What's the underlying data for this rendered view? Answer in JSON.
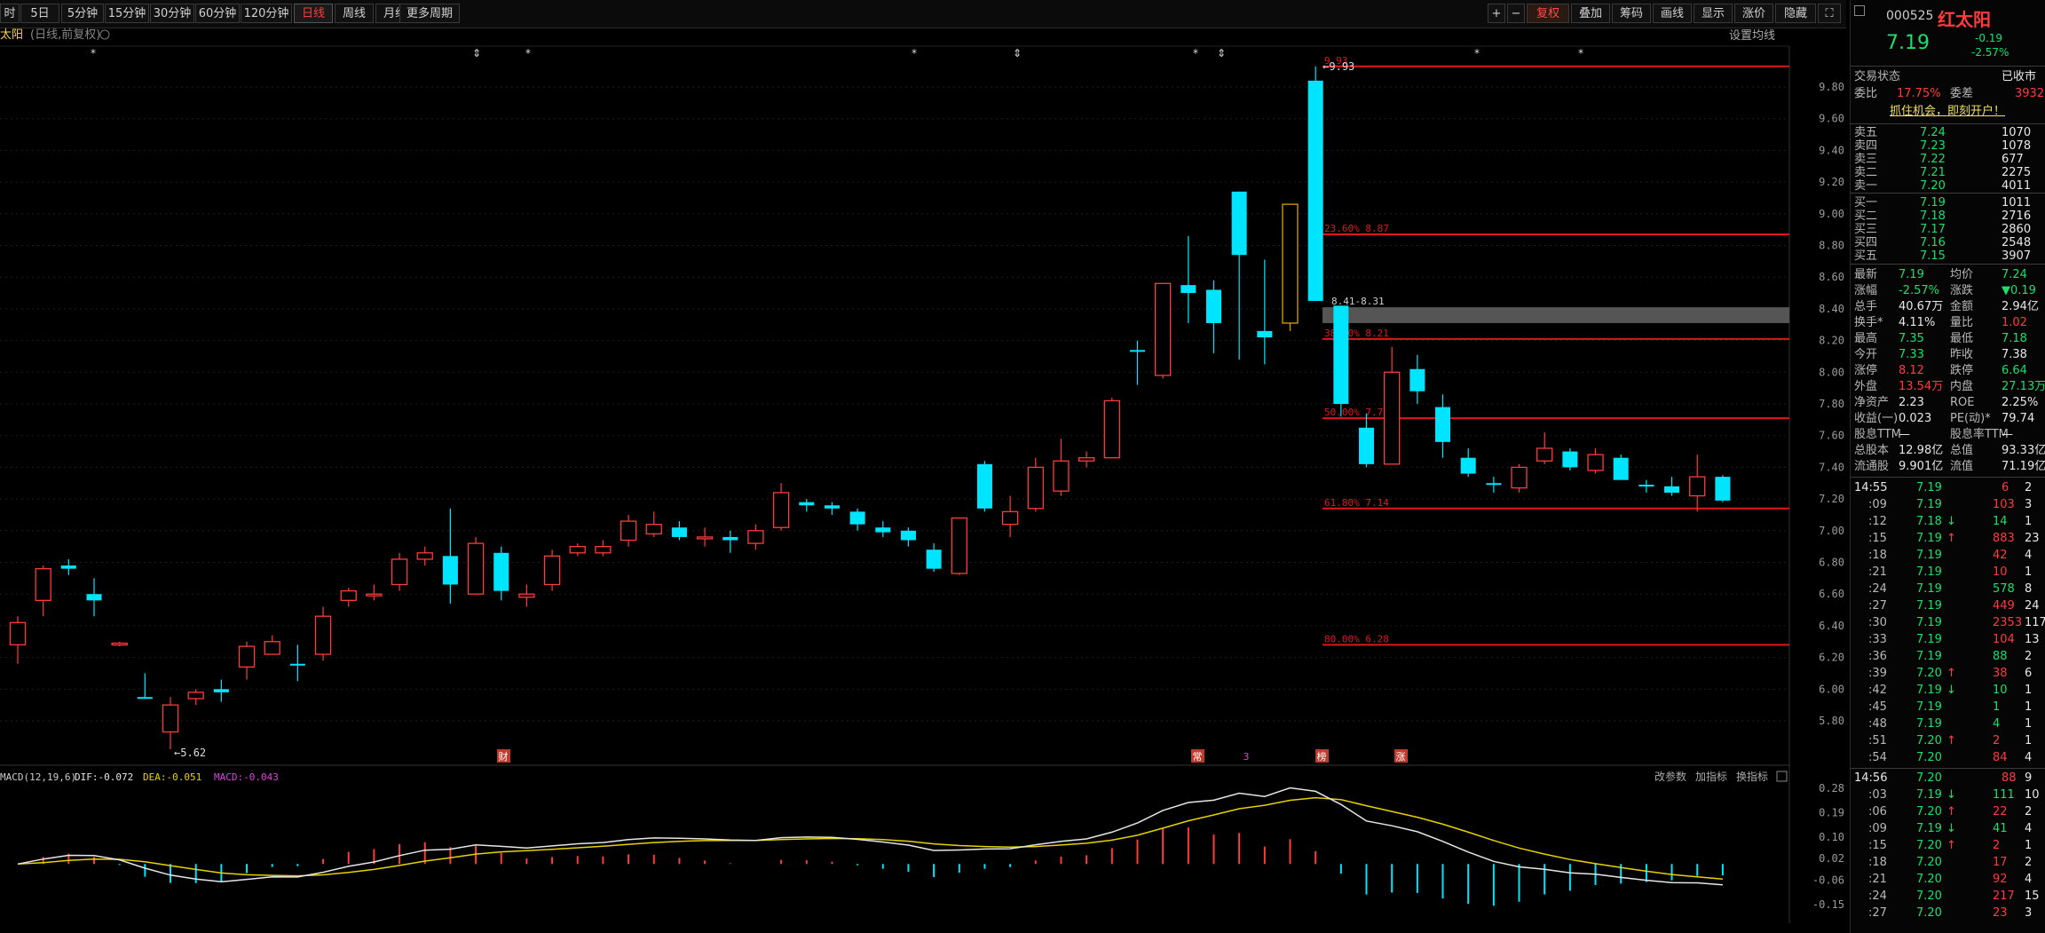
{
  "toolbar": {
    "periods": [
      "时",
      "5日",
      "5分钟",
      "15分钟",
      "30分钟",
      "60分钟",
      "120分钟",
      "日线",
      "周线",
      "月线",
      "更多周期"
    ],
    "active_period": "日线",
    "right_tools": [
      "+",
      "−",
      "复权",
      "叠加",
      "筹码",
      "画线",
      "显示",
      "涨价",
      "隐藏",
      "⛶"
    ]
  },
  "chart": {
    "stock_label": "太阳",
    "period_note": "(日线,前复权)",
    "setting_avg": "设置均线",
    "high_marker": "9.93",
    "low_marker": "5.62",
    "range_label": "8.41-8.31",
    "event_badges": [
      "财",
      "常",
      "3",
      "榜",
      "涨"
    ],
    "fib_labels": [
      {
        "label": "9.93"
      },
      {
        "label": "23.60% 8.87"
      },
      {
        "label": "38.20% 8.21"
      },
      {
        "label": "50.00% 7.71"
      },
      {
        "label": "61.80% 7.14"
      },
      {
        "label": "80.00% 6.28"
      }
    ],
    "y_ticks": [
      "9.80",
      "9.60",
      "9.40",
      "9.20",
      "9.00",
      "8.80",
      "8.60",
      "8.40",
      "8.20",
      "8.00",
      "7.80",
      "7.60",
      "7.40",
      "7.20",
      "7.00",
      "6.80",
      "6.60",
      "6.40",
      "6.20",
      "6.00",
      "5.80"
    ]
  },
  "chart_data": {
    "type": "candlestick",
    "title": "红太阳 日线 前复权",
    "ylim": [
      5.6,
      9.95
    ],
    "candles": [
      [
        6.28,
        6.42,
        6.46,
        6.16
      ],
      [
        6.56,
        6.76,
        6.78,
        6.46
      ],
      [
        6.78,
        6.76,
        6.82,
        6.72
      ],
      [
        6.6,
        6.56,
        6.7,
        6.46
      ],
      [
        6.28,
        6.29,
        6.3,
        6.27
      ],
      [
        5.95,
        5.94,
        6.1,
        5.94
      ],
      [
        5.73,
        5.9,
        5.95,
        5.62
      ],
      [
        5.94,
        5.98,
        6.0,
        5.9
      ],
      [
        6.0,
        5.98,
        6.06,
        5.92
      ],
      [
        6.14,
        6.27,
        6.3,
        6.06
      ],
      [
        6.22,
        6.3,
        6.34,
        6.22
      ],
      [
        6.16,
        6.15,
        6.28,
        6.05
      ],
      [
        6.22,
        6.46,
        6.52,
        6.18
      ],
      [
        6.56,
        6.62,
        6.64,
        6.52
      ],
      [
        6.6,
        6.6,
        6.66,
        6.56
      ],
      [
        6.66,
        6.82,
        6.86,
        6.62
      ],
      [
        6.82,
        6.86,
        6.9,
        6.78
      ],
      [
        6.84,
        6.66,
        7.14,
        6.54
      ],
      [
        6.6,
        6.92,
        6.96,
        6.6
      ],
      [
        6.86,
        6.62,
        6.9,
        6.56
      ],
      [
        6.58,
        6.6,
        6.66,
        6.52
      ],
      [
        6.66,
        6.84,
        6.88,
        6.62
      ],
      [
        6.86,
        6.9,
        6.92,
        6.84
      ],
      [
        6.86,
        6.9,
        6.94,
        6.84
      ],
      [
        6.94,
        7.06,
        7.1,
        6.9
      ],
      [
        6.98,
        7.04,
        7.12,
        6.96
      ],
      [
        7.02,
        6.96,
        7.06,
        6.94
      ],
      [
        6.96,
        6.96,
        7.02,
        6.9
      ],
      [
        6.96,
        6.94,
        7.0,
        6.86
      ],
      [
        6.92,
        7.0,
        7.04,
        6.88
      ],
      [
        7.02,
        7.24,
        7.3,
        7.0
      ],
      [
        7.18,
        7.16,
        7.2,
        7.12
      ],
      [
        7.16,
        7.14,
        7.18,
        7.1
      ],
      [
        7.12,
        7.04,
        7.14,
        7.0
      ],
      [
        7.02,
        6.99,
        7.06,
        6.96
      ],
      [
        7.0,
        6.94,
        7.02,
        6.9
      ],
      [
        6.88,
        6.76,
        6.92,
        6.74
      ],
      [
        6.73,
        7.08,
        7.08,
        6.72
      ],
      [
        7.42,
        7.14,
        7.44,
        7.12
      ],
      [
        7.04,
        7.12,
        7.22,
        6.96
      ],
      [
        7.14,
        7.4,
        7.46,
        7.12
      ],
      [
        7.25,
        7.44,
        7.58,
        7.22
      ],
      [
        7.44,
        7.46,
        7.5,
        7.4
      ],
      [
        7.46,
        7.82,
        7.84,
        7.46
      ],
      [
        8.14,
        8.13,
        8.2,
        7.92
      ],
      [
        7.98,
        8.56,
        8.56,
        7.96
      ],
      [
        8.55,
        8.5,
        8.86,
        8.31
      ],
      [
        8.52,
        8.31,
        8.58,
        8.12
      ],
      [
        9.14,
        8.74,
        9.14,
        8.08
      ],
      [
        8.26,
        8.22,
        8.71,
        8.05
      ],
      [
        8.31,
        9.06,
        9.06,
        8.26
      ],
      [
        9.84,
        8.45,
        9.93,
        8.45
      ],
      [
        8.42,
        7.8,
        8.42,
        7.72
      ],
      [
        7.65,
        7.42,
        7.74,
        7.4
      ],
      [
        7.42,
        8.0,
        8.16,
        7.42
      ],
      [
        8.02,
        7.88,
        8.11,
        7.8
      ],
      [
        7.78,
        7.56,
        7.86,
        7.46
      ],
      [
        7.46,
        7.36,
        7.52,
        7.34
      ],
      [
        7.3,
        7.29,
        7.34,
        7.24
      ],
      [
        7.27,
        7.4,
        7.42,
        7.24
      ],
      [
        7.44,
        7.52,
        7.62,
        7.42
      ],
      [
        7.5,
        7.4,
        7.52,
        7.38
      ],
      [
        7.38,
        7.48,
        7.52,
        7.36
      ],
      [
        7.46,
        7.32,
        7.48,
        7.32
      ],
      [
        7.29,
        7.28,
        7.32,
        7.24
      ],
      [
        7.28,
        7.24,
        7.34,
        7.22
      ],
      [
        7.22,
        7.34,
        7.48,
        7.12
      ],
      [
        7.34,
        7.19,
        7.35,
        7.18
      ]
    ],
    "macd": {
      "title": "MACD(12,19,6)",
      "dif": "-0.072",
      "dea": "-0.051",
      "macd": "-0.043",
      "y_ticks": [
        "0.28",
        "0.19",
        "0.10",
        "0.02",
        "-0.06",
        "-0.15"
      ]
    }
  },
  "macd_panel": {
    "title": "MACD(12,19,6)",
    "dif": "DIF:-0.072",
    "dea": "DEA:-0.051",
    "macd": "MACD:-0.043",
    "actions": [
      "改参数",
      "加指标",
      "换指标"
    ]
  },
  "quote": {
    "code": "000525",
    "name": "红太阳",
    "price": "7.19",
    "change": "-0.19",
    "change_pct": "-2.57%",
    "status_label": "交易状态",
    "status_value": "已收市",
    "ratio_label": "委比",
    "ratio_value": "17.75%",
    "diff_label": "委差",
    "diff_value": "3932",
    "ad": "抓住机会，即刻开户！",
    "asks": [
      {
        "label": "卖五",
        "price": "7.24",
        "vol": "1070"
      },
      {
        "label": "卖四",
        "price": "7.23",
        "vol": "1078"
      },
      {
        "label": "卖三",
        "price": "7.22",
        "vol": "677"
      },
      {
        "label": "卖二",
        "price": "7.21",
        "vol": "2275"
      },
      {
        "label": "卖一",
        "price": "7.20",
        "vol": "4011"
      }
    ],
    "bids": [
      {
        "label": "买一",
        "price": "7.19",
        "vol": "1011"
      },
      {
        "label": "买二",
        "price": "7.18",
        "vol": "2716"
      },
      {
        "label": "买三",
        "price": "7.17",
        "vol": "2860"
      },
      {
        "label": "买四",
        "price": "7.16",
        "vol": "2548"
      },
      {
        "label": "买五",
        "price": "7.15",
        "vol": "3907"
      }
    ],
    "stats": [
      {
        "l1": "最新",
        "v1": "7.19",
        "c1": "grn",
        "l2": "均价",
        "v2": "7.24",
        "c2": "grn"
      },
      {
        "l1": "涨幅",
        "v1": "-2.57%",
        "c1": "grn",
        "l2": "涨跌",
        "v2": "▼0.19",
        "c2": "grn"
      },
      {
        "l1": "总手",
        "v1": "40.67万",
        "c1": "wht",
        "l2": "金额",
        "v2": "2.94亿",
        "c2": "wht"
      },
      {
        "l1": "换手*",
        "v1": "4.11%",
        "c1": "wht",
        "l2": "量比",
        "v2": "1.02",
        "c2": "red"
      },
      {
        "l1": "最高",
        "v1": "7.35",
        "c1": "grn",
        "l2": "最低",
        "v2": "7.18",
        "c2": "grn"
      },
      {
        "l1": "今开",
        "v1": "7.33",
        "c1": "grn",
        "l2": "昨收",
        "v2": "7.38",
        "c2": "wht"
      },
      {
        "l1": "涨停",
        "v1": "8.12",
        "c1": "red",
        "l2": "跌停",
        "v2": "6.64",
        "c2": "grn"
      },
      {
        "l1": "外盘",
        "v1": "13.54万",
        "c1": "red",
        "l2": "内盘",
        "v2": "27.13万",
        "c2": "grn"
      },
      {
        "l1": "净资产",
        "v1": "2.23",
        "c1": "wht",
        "l2": "ROE",
        "v2": "2.25%",
        "c2": "wht"
      },
      {
        "l1": "收益(一)",
        "v1": "0.023",
        "c1": "wht",
        "l2": "PE(动)*",
        "v2": "79.74",
        "c2": "wht"
      },
      {
        "l1": "股息TTM",
        "v1": "—",
        "c1": "wht",
        "l2": "股息率TTM",
        "v2": "—",
        "c2": "wht"
      },
      {
        "l1": "总股本",
        "v1": "12.98亿",
        "c1": "wht",
        "l2": "总值",
        "v2": "93.33亿",
        "c2": "wht"
      },
      {
        "l1": "流通股",
        "v1": "9.901亿",
        "c1": "wht",
        "l2": "流值",
        "v2": "71.19亿",
        "c2": "wht"
      }
    ],
    "ticks1_time": "14:55",
    "ticks1": [
      {
        "t": ":09",
        "p": "7.19",
        "pc": "grn",
        "a": "",
        "v": "103",
        "vc": "red",
        "n": "3"
      },
      {
        "t": ":12",
        "p": "7.18",
        "pc": "grn",
        "a": "↓",
        "v": "14",
        "vc": "grn",
        "n": "1"
      },
      {
        "t": ":15",
        "p": "7.19",
        "pc": "grn",
        "a": "↑",
        "v": "883",
        "vc": "red",
        "n": "23"
      },
      {
        "t": ":18",
        "p": "7.19",
        "pc": "grn",
        "a": "",
        "v": "42",
        "vc": "red",
        "n": "4"
      },
      {
        "t": ":21",
        "p": "7.19",
        "pc": "grn",
        "a": "",
        "v": "10",
        "vc": "red",
        "n": "1"
      },
      {
        "t": ":24",
        "p": "7.19",
        "pc": "grn",
        "a": "",
        "v": "578",
        "vc": "grn",
        "n": "8"
      },
      {
        "t": ":27",
        "p": "7.19",
        "pc": "grn",
        "a": "",
        "v": "449",
        "vc": "red",
        "n": "24"
      },
      {
        "t": ":30",
        "p": "7.19",
        "pc": "grn",
        "a": "",
        "v": "2353",
        "vc": "red",
        "n": "117"
      },
      {
        "t": ":33",
        "p": "7.19",
        "pc": "grn",
        "a": "",
        "v": "104",
        "vc": "red",
        "n": "13"
      },
      {
        "t": ":36",
        "p": "7.19",
        "pc": "grn",
        "a": "",
        "v": "88",
        "vc": "grn",
        "n": "2"
      },
      {
        "t": ":39",
        "p": "7.20",
        "pc": "grn",
        "a": "↑",
        "v": "38",
        "vc": "red",
        "n": "6"
      },
      {
        "t": ":42",
        "p": "7.19",
        "pc": "grn",
        "a": "↓",
        "v": "10",
        "vc": "grn",
        "n": "1"
      },
      {
        "t": ":45",
        "p": "7.19",
        "pc": "grn",
        "a": "",
        "v": "1",
        "vc": "grn",
        "n": "1"
      },
      {
        "t": ":48",
        "p": "7.19",
        "pc": "grn",
        "a": "",
        "v": "4",
        "vc": "grn",
        "n": "1"
      },
      {
        "t": ":51",
        "p": "7.20",
        "pc": "grn",
        "a": "↑",
        "v": "2",
        "vc": "red",
        "n": "1"
      },
      {
        "t": ":54",
        "p": "7.20",
        "pc": "grn",
        "a": "",
        "v": "84",
        "vc": "red",
        "n": "4"
      }
    ],
    "ticks1_first": {
      "p": "7.19",
      "v": "6",
      "n": "2"
    },
    "ticks2_time": "14:56",
    "ticks2_first": {
      "p": "7.20",
      "v": "88",
      "n": "9"
    },
    "ticks2": [
      {
        "t": ":03",
        "p": "7.19",
        "pc": "grn",
        "a": "↓",
        "v": "111",
        "vc": "grn",
        "n": "10"
      },
      {
        "t": ":06",
        "p": "7.20",
        "pc": "grn",
        "a": "↑",
        "v": "22",
        "vc": "red",
        "n": "2"
      },
      {
        "t": ":09",
        "p": "7.19",
        "pc": "grn",
        "a": "↓",
        "v": "41",
        "vc": "grn",
        "n": "4"
      },
      {
        "t": ":15",
        "p": "7.20",
        "pc": "grn",
        "a": "↑",
        "v": "2",
        "vc": "red",
        "n": "1"
      },
      {
        "t": ":18",
        "p": "7.20",
        "pc": "grn",
        "a": "",
        "v": "17",
        "vc": "red",
        "n": "2"
      },
      {
        "t": ":21",
        "p": "7.20",
        "pc": "grn",
        "a": "",
        "v": "92",
        "vc": "red",
        "n": "4"
      },
      {
        "t": ":24",
        "p": "7.20",
        "pc": "grn",
        "a": "",
        "v": "217",
        "vc": "red",
        "n": "15"
      },
      {
        "t": ":27",
        "p": "7.20",
        "pc": "grn",
        "a": "",
        "v": "23",
        "vc": "red",
        "n": "3"
      }
    ]
  },
  "colors": {
    "up": "#ff3b3b",
    "down": "#00e5ff",
    "limit": "#d9a000",
    "fib": "#e01818",
    "dif": "#e6e6e6",
    "dea": "#e6d200"
  }
}
